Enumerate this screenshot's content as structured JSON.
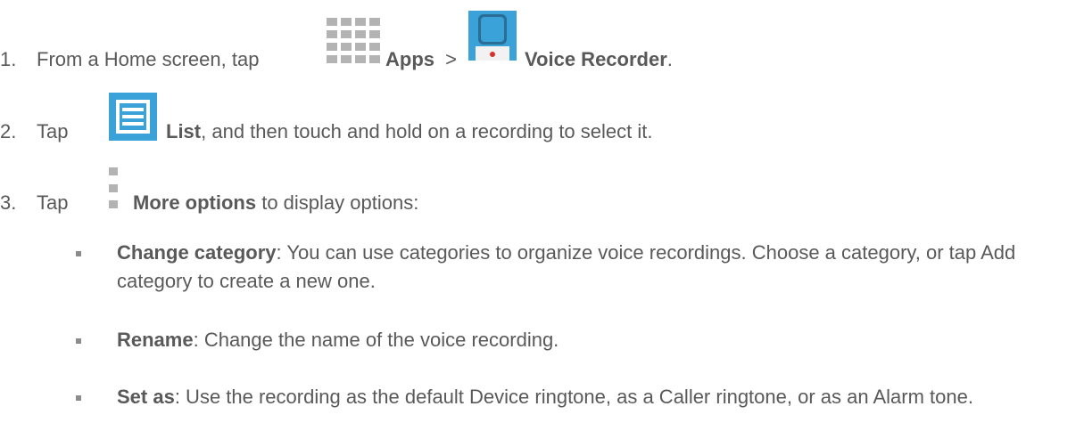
{
  "steps": [
    {
      "number": "1.",
      "lead": "From a Home screen, tap",
      "apps_label": "Apps",
      "separator": ">",
      "voice_recorder_label": "Voice Recorder",
      "end": "."
    },
    {
      "number": "2.",
      "lead": "Tap",
      "list_label": "List",
      "rest": ", and then touch and hold on a recording to select it."
    },
    {
      "number": "3.",
      "lead": "Tap",
      "more_label": "More options",
      "rest": " to display options:"
    }
  ],
  "options": [
    {
      "term": "Change category",
      "description": ": You can use categories to organize voice recordings. Choose a category, or tap Add category to create a new one."
    },
    {
      "term": "Rename",
      "description": ": Change the name of the voice recording."
    },
    {
      "term": "Set as",
      "description": ": Use the recording as the default Device ringtone, as a Caller ringtone, or as an Alarm tone."
    }
  ],
  "icons": {
    "apps": "apps-grid-icon",
    "voice_recorder": "voice-recorder-icon",
    "list": "list-icon",
    "more_options": "more-options-icon"
  },
  "colors": {
    "text": "#595959",
    "icon_grey": "#b3b3b3",
    "icon_blue": "#3aa2d8",
    "icon_red": "#d9302a"
  }
}
